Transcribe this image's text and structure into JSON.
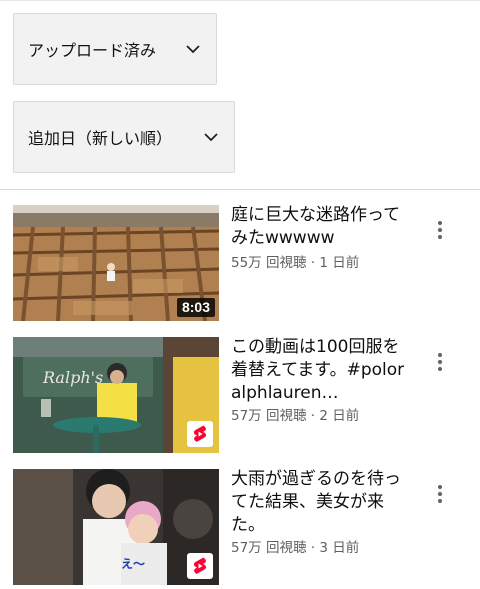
{
  "filters": {
    "type_label": "アップロード済み",
    "sort_label": "追加日（新しい順）"
  },
  "videos": [
    {
      "title": "庭に巨大な迷路作ってみたwwwww",
      "views": "55万 回視聴",
      "age": "1 日前",
      "separator": "·",
      "duration": "8:03",
      "badge": ""
    },
    {
      "title": "この動画は100回服を着替えてます。#poloralphlauren…",
      "views": "57万 回視聴",
      "age": "2 日前",
      "separator": "·",
      "duration": "",
      "badge": "shorts-icon"
    },
    {
      "title": "大雨が過ぎるのを待ってた結果、美女が来た。",
      "views": "57万 回視聴",
      "age": "3 日前",
      "separator": "·",
      "duration": "",
      "badge": "shorts-icon",
      "thumb_caption": "え〜"
    }
  ],
  "colors": {
    "accent_red": "#ff0033",
    "meta_gray": "#606060"
  }
}
